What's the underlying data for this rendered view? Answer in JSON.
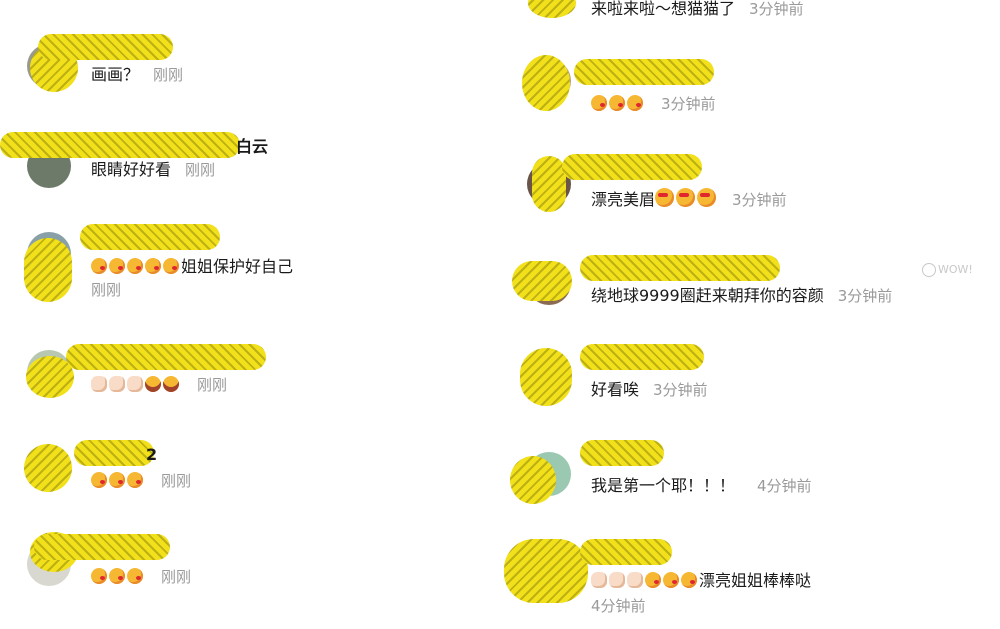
{
  "left_comments": [
    {
      "text": "画画？",
      "time": "刚刚",
      "emojis": []
    },
    {
      "text": "眼睛好好看",
      "time": "刚刚",
      "emojis": [],
      "name_suffix": "白云"
    },
    {
      "text": "姐姐保护好自己",
      "time": "刚刚",
      "emojis": [
        "kiss",
        "kiss",
        "kiss",
        "kiss",
        "kiss"
      ]
    },
    {
      "text": "",
      "time": "刚刚",
      "emojis": [
        "clap",
        "clap",
        "clap",
        "laugh",
        "laugh"
      ]
    },
    {
      "text": "",
      "time": "刚刚",
      "emojis": [
        "kiss",
        "kiss",
        "kiss"
      ],
      "name_suffix": "2"
    },
    {
      "text": "",
      "time": "刚刚",
      "emojis": [
        "kiss",
        "kiss",
        "kiss"
      ]
    }
  ],
  "right_comments": [
    {
      "text": "来啦来啦～想猫猫了",
      "time": "3分钟前",
      "emojis": []
    },
    {
      "text": "",
      "time": "3分钟前",
      "emojis": [
        "kiss",
        "kiss",
        "kiss"
      ]
    },
    {
      "text": "漂亮美眉",
      "time": "3分钟前",
      "emojis_after": [
        "heart",
        "heart",
        "heart"
      ]
    },
    {
      "text": "绕地球9999圈赶来朝拜你的容颜",
      "time": "3分钟前"
    },
    {
      "text": "好看唉",
      "time": "3分钟前"
    },
    {
      "text": "我是第一个耶！！！",
      "time": "4分钟前"
    },
    {
      "text": "漂亮姐姐棒棒哒",
      "time": "4分钟前",
      "emojis": [
        "clap",
        "clap",
        "clap",
        "kiss",
        "kiss",
        "kiss"
      ]
    }
  ],
  "wow_label": "WOW!"
}
